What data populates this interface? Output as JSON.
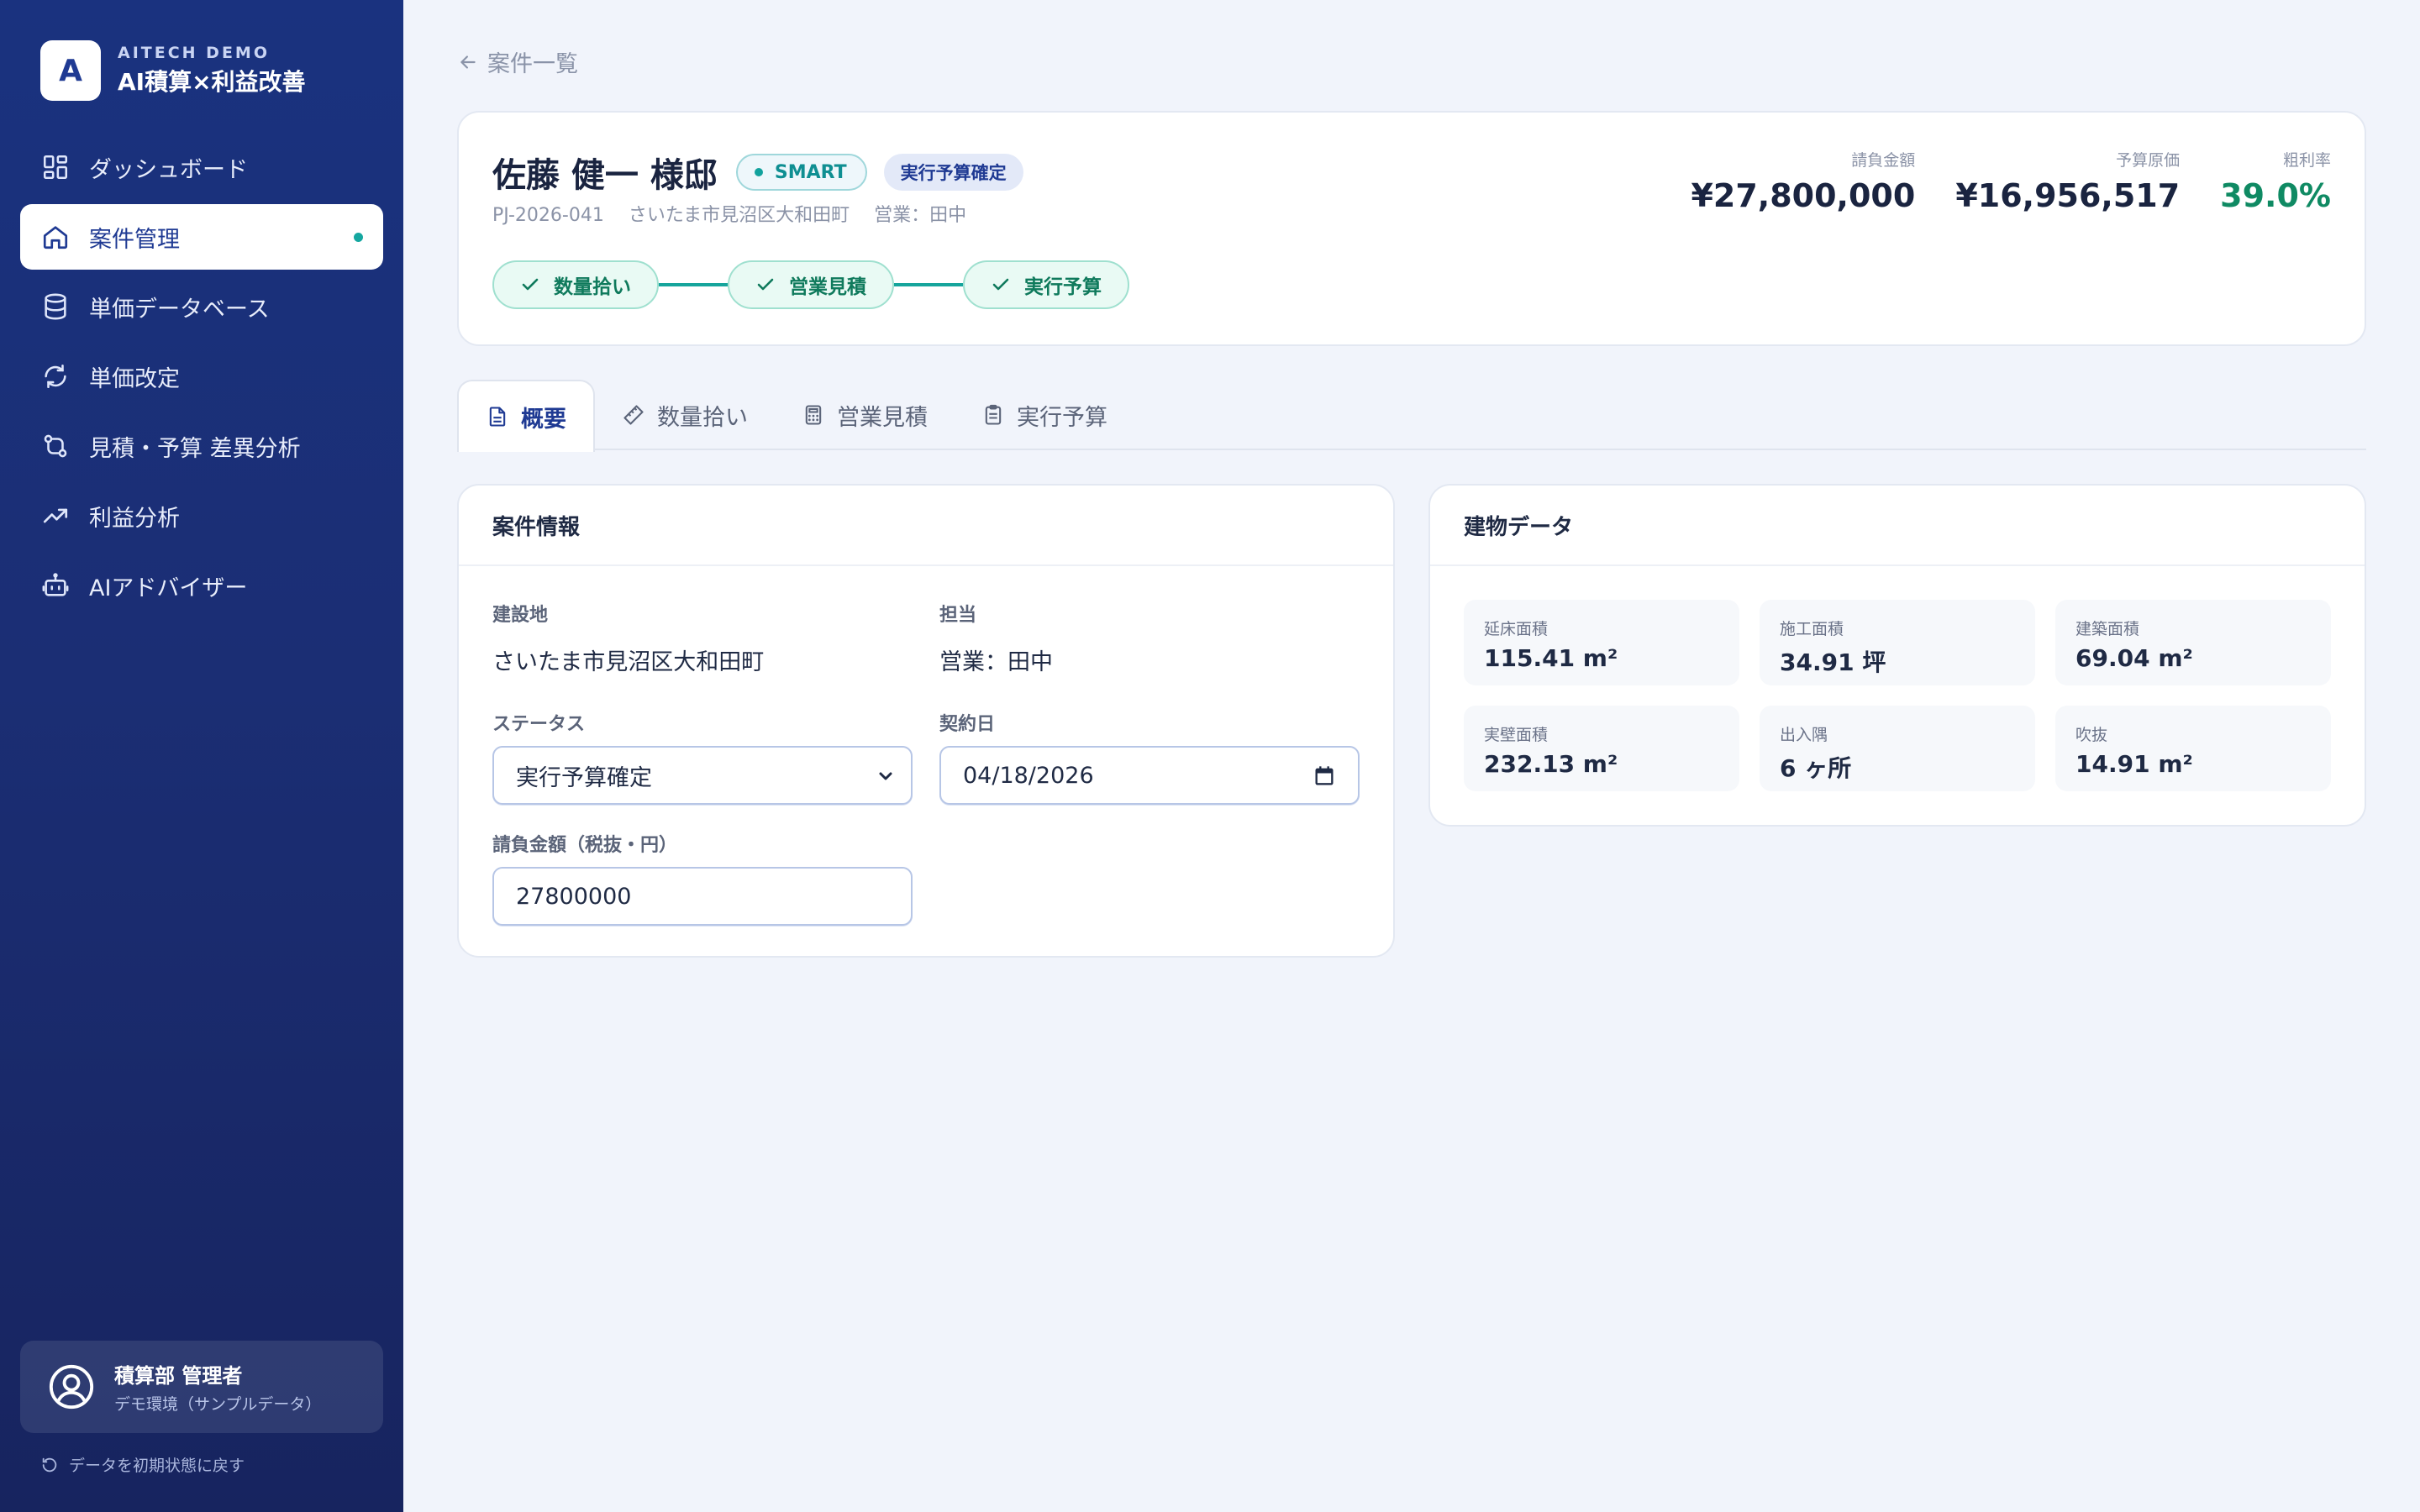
{
  "brand": {
    "logo_letter": "A",
    "sub": "AITECH DEMO",
    "title": "AI積算×利益改善"
  },
  "nav": {
    "items": [
      {
        "label": "ダッシュボード",
        "icon": "dashboard-icon"
      },
      {
        "label": "案件管理",
        "icon": "home-icon",
        "active": true
      },
      {
        "label": "単価データベース",
        "icon": "database-icon"
      },
      {
        "label": "単価改定",
        "icon": "refresh-icon"
      },
      {
        "label": "見積・予算 差異分析",
        "icon": "compare-icon"
      },
      {
        "label": "利益分析",
        "icon": "trending-up-icon"
      },
      {
        "label": "AIアドバイザー",
        "icon": "bot-icon"
      }
    ]
  },
  "user": {
    "name": "積算部 管理者",
    "sub": "デモ環境（サンプルデータ）"
  },
  "reset_label": "データを初期状態に戻す",
  "back_label": "案件一覧",
  "project": {
    "title": "佐藤 健一 様邸",
    "badge_type": "SMART",
    "badge_status": "実行予算確定",
    "code": "PJ-2026-041",
    "location": "さいたま市見沼区大和田町",
    "sales": "営業：田中",
    "steps": [
      "数量拾い",
      "営業見積",
      "実行予算"
    ]
  },
  "kpis": [
    {
      "label": "請負金額",
      "value": "¥27,800,000"
    },
    {
      "label": "予算原価",
      "value": "¥16,956,517"
    },
    {
      "label": "粗利率",
      "value": "39.0%"
    }
  ],
  "tabs": [
    {
      "label": "概要",
      "icon": "document-icon"
    },
    {
      "label": "数量拾い",
      "icon": "ruler-icon"
    },
    {
      "label": "営業見積",
      "icon": "calculator-icon"
    },
    {
      "label": "実行予算",
      "icon": "clipboard-icon"
    }
  ],
  "info": {
    "title": "案件情報",
    "site_label": "建設地",
    "site_value": "さいたま市見沼区大和田町",
    "owner_label": "担当",
    "owner_value": "営業：田中",
    "status_label": "ステータス",
    "status_value": "実行予算確定",
    "contract_label": "契約日",
    "contract_value": "04/18/2026",
    "amount_label": "請負金額（税抜・円）",
    "amount_value": "27800000"
  },
  "building": {
    "title": "建物データ",
    "stats": [
      {
        "label": "延床面積",
        "value": "115.41 m²"
      },
      {
        "label": "施工面積",
        "value": "34.91 坪"
      },
      {
        "label": "建築面積",
        "value": "69.04 m²"
      },
      {
        "label": "実壁面積",
        "value": "232.13 m²"
      },
      {
        "label": "出入隅",
        "value": "6 ヶ所"
      },
      {
        "label": "吹抜",
        "value": "14.91 m²"
      }
    ]
  },
  "colors": {
    "sidebar": "#1b2e74",
    "accent": "#1f3a93",
    "teal": "#15a7a0",
    "green": "#0f8a63"
  }
}
